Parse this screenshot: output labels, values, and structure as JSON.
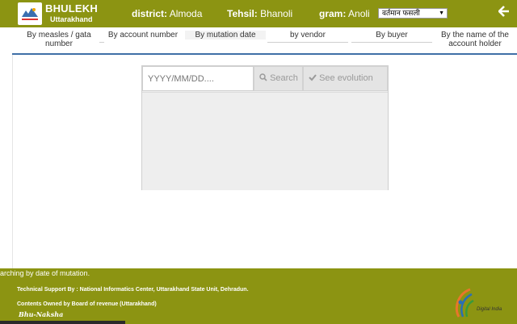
{
  "header": {
    "brand_title": "BHULEKH",
    "brand_subtitle": "Uttarakhand",
    "district_label": "district:",
    "district_value": "Almoda",
    "tehsil_label": "Tehsil:",
    "tehsil_value": "Bhanoli",
    "gram_label": "gram:",
    "gram_value": "Anoli",
    "crop_select_value": "वर्तमान फसली",
    "back_icon": "arrow-left-icon"
  },
  "tabs": [
    {
      "label": "By measles / gata number"
    },
    {
      "label": "By account number"
    },
    {
      "label": "By mutation date",
      "active": true
    },
    {
      "label": "by vendor"
    },
    {
      "label": "By buyer"
    },
    {
      "label": "By the name of the account holder"
    }
  ],
  "search": {
    "date_placeholder": "YYYY/MM/DD....",
    "search_label": "Search",
    "evolution_label": "See evolution"
  },
  "footer": {
    "status_message": "arching by date of mutation.",
    "tech_support": "Technical Support By : National Informatics Center, Uttarakhand State Unit, Dehradun.",
    "owned_by": "Contents Owned by Board of revenue (Uttarakhand)",
    "bhunaksha": "Bhu-Naksha",
    "digital_india": "Digital India"
  },
  "colors": {
    "header_bg": "#8c9412",
    "tab_underline": "#3f6fa6",
    "panel_bg": "#eeeeee"
  }
}
